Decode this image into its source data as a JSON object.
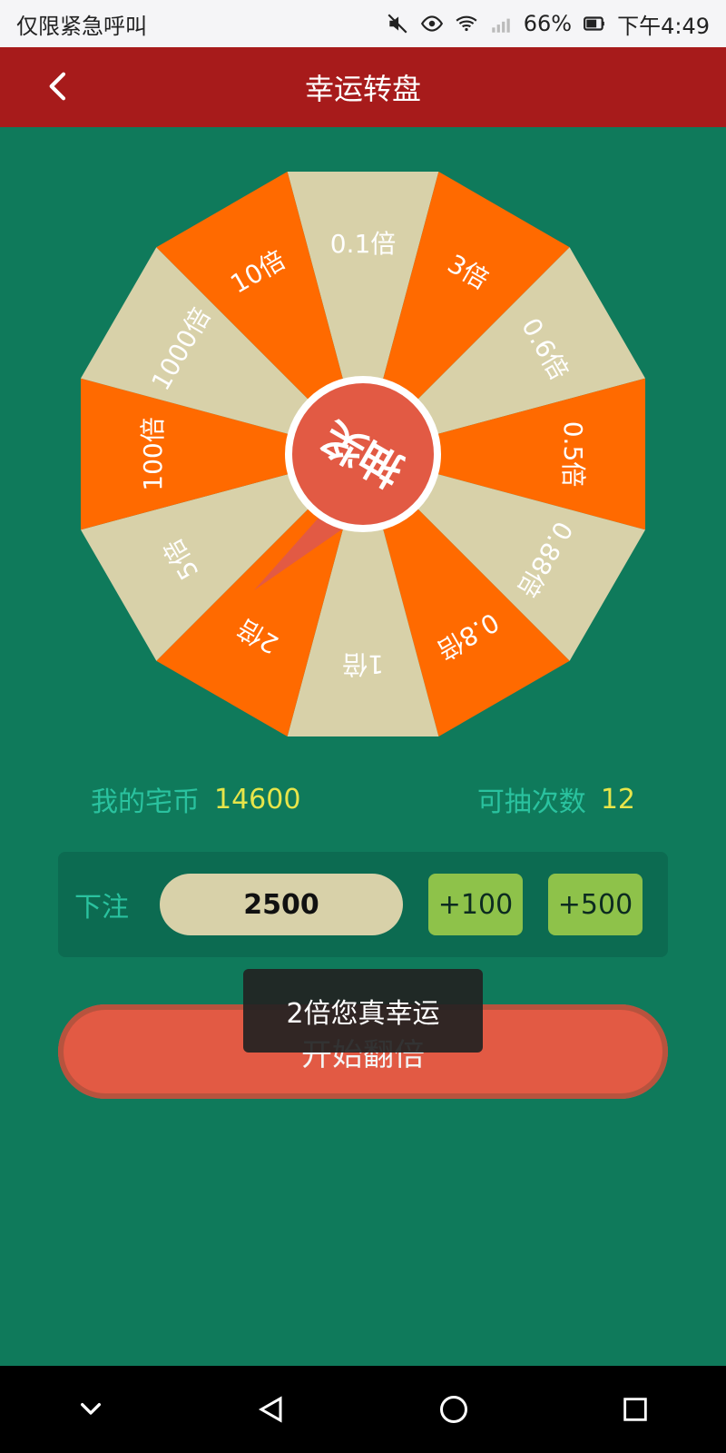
{
  "status_bar": {
    "left_text": "仅限紧急呼叫",
    "battery": "66%",
    "time": "下午4:49",
    "icons": [
      "mute-icon",
      "eye-icon",
      "wifi-icon",
      "signal-icon",
      "battery-icon"
    ]
  },
  "app_bar": {
    "title": "幸运转盘",
    "back_icon": "chevron-left-icon",
    "colors": {
      "bar": "#a71b1b"
    }
  },
  "wheel": {
    "segments": [
      {
        "label": "0.1倍",
        "color": "#d8d1a9"
      },
      {
        "label": "3倍",
        "color": "#ff6a00"
      },
      {
        "label": "0.6倍",
        "color": "#d8d1a9"
      },
      {
        "label": "0.5倍",
        "color": "#ff6a00"
      },
      {
        "label": "0.88倍",
        "color": "#d8d1a9"
      },
      {
        "label": "0.8倍",
        "color": "#ff6a00"
      },
      {
        "label": "1倍",
        "color": "#d8d1a9"
      },
      {
        "label": "2倍",
        "color": "#ff6a00"
      },
      {
        "label": "5倍",
        "color": "#d8d1a9"
      },
      {
        "label": "100倍",
        "color": "#ff6a00"
      },
      {
        "label": "1000倍",
        "color": "#d8d1a9"
      },
      {
        "label": "10倍",
        "color": "#ff6a00"
      }
    ],
    "center_text": "抽奖"
  },
  "stats": {
    "coins_label": "我的宅币",
    "coins_value": "14600",
    "draws_label": "可抽次数",
    "draws_value": "12"
  },
  "bet": {
    "label": "下注",
    "amount": "2500",
    "btn_100": "+100",
    "btn_500": "+500"
  },
  "start_button": {
    "label": "开始翻倍"
  },
  "toast": {
    "text": "2倍您真幸运"
  },
  "nav": {
    "icons": [
      "chevron-down-icon",
      "back-triangle-icon",
      "home-circle-icon",
      "recent-square-icon"
    ]
  }
}
